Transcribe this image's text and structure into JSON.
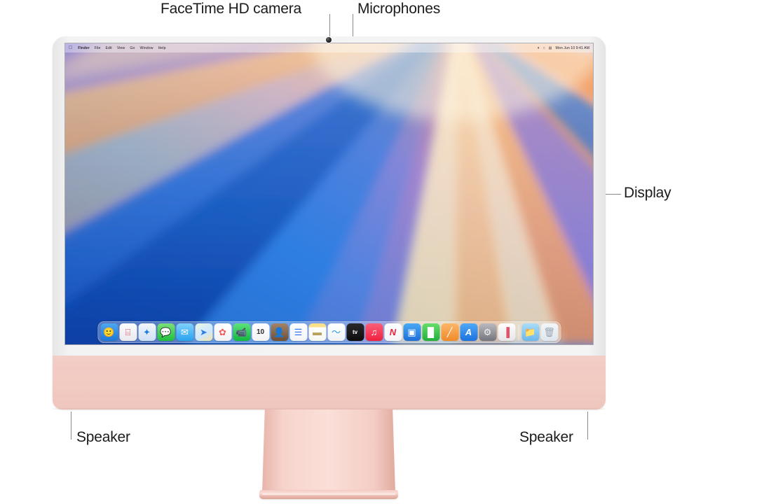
{
  "figure": {
    "title": "iMac front view with callouts",
    "device": "iMac",
    "body_color": "#f2cbc3",
    "bezel_color": "#f0f0f1"
  },
  "callouts": [
    {
      "id": "facetime-camera",
      "label": "FaceTime HD camera"
    },
    {
      "id": "microphones",
      "label": "Microphones"
    },
    {
      "id": "display",
      "label": "Display"
    },
    {
      "id": "speaker-left",
      "label": "Speaker"
    },
    {
      "id": "speaker-right",
      "label": "Speaker"
    }
  ],
  "screen": {
    "menubar": {
      "apple_glyph": "",
      "left_items": [
        {
          "label": "Finder",
          "bold": true
        },
        {
          "label": "File",
          "bold": false
        },
        {
          "label": "Edit",
          "bold": false
        },
        {
          "label": "View",
          "bold": false
        },
        {
          "label": "Go",
          "bold": false
        },
        {
          "label": "Window",
          "bold": false
        },
        {
          "label": "Help",
          "bold": false
        }
      ],
      "right_icons": [
        {
          "name": "wifi-icon",
          "glyph": "▾"
        },
        {
          "name": "search-icon",
          "glyph": "○"
        },
        {
          "name": "control-center-icon",
          "glyph": "▤"
        }
      ],
      "clock": "Mon Jun 10  9:41 AM"
    },
    "wallpaper": {
      "name": "macOS Sequoia rays",
      "colors": [
        "#1452b8",
        "#2f7ee0",
        "#7b79d6",
        "#b07fc4",
        "#f09a5c",
        "#f7c189",
        "#fbe0b4",
        "#fdf0d8"
      ]
    },
    "dock": {
      "items": [
        {
          "name": "finder",
          "label": "Finder",
          "glyph": "🙂",
          "bg": "linear-gradient(180deg,#4ea7f0,#1e76d8)",
          "fg": "#ffffff"
        },
        {
          "name": "launchpad",
          "label": "Launchpad",
          "glyph": "⌸",
          "bg": "linear-gradient(180deg,#fdfdfd,#e9e9ef)",
          "fg": "#d8485f"
        },
        {
          "name": "safari",
          "label": "Safari",
          "glyph": "✦",
          "bg": "linear-gradient(180deg,#f2f6fb,#cfe0f4)",
          "fg": "#1f7fe0"
        },
        {
          "name": "messages",
          "label": "Messages",
          "glyph": "💬",
          "bg": "linear-gradient(180deg,#7ce07b,#1fbf3d)",
          "fg": "#ffffff"
        },
        {
          "name": "mail",
          "label": "Mail",
          "glyph": "✉",
          "bg": "linear-gradient(180deg,#7fd0fb,#2aa2ef)",
          "fg": "#ffffff"
        },
        {
          "name": "maps",
          "label": "Maps",
          "glyph": "➤",
          "bg": "linear-gradient(150deg,#e7f6e2 0%,#cfe9ff 55%,#f6e6a8 100%)",
          "fg": "#2f7ee0"
        },
        {
          "name": "photos",
          "label": "Photos",
          "glyph": "✿",
          "bg": "linear-gradient(180deg,#ffffff,#f2f2f5)",
          "fg": "#f05a5a"
        },
        {
          "name": "facetime",
          "label": "FaceTime",
          "glyph": "📹",
          "bg": "linear-gradient(180deg,#5ee17a,#12b83e)",
          "fg": "#ffffff"
        },
        {
          "name": "calendar",
          "label": "Calendar",
          "glyph": "10",
          "bg": "linear-gradient(180deg,#ffffff,#f3f3f6)",
          "fg": "#2b2b2e"
        },
        {
          "name": "contacts",
          "label": "Contacts",
          "glyph": "👤",
          "bg": "linear-gradient(180deg,#a1846a,#6d4f36)",
          "fg": "#f3e7d8"
        },
        {
          "name": "reminders",
          "label": "Reminders",
          "glyph": "☰",
          "bg": "linear-gradient(180deg,#ffffff,#f4f4f7)",
          "fg": "#3478f6"
        },
        {
          "name": "notes",
          "label": "Notes",
          "glyph": "▬",
          "bg": "linear-gradient(180deg,#fbe08a 0%,#fbe08a 22%,#ffffff 22%,#f6f6f2 100%)",
          "fg": "#b9a15e"
        },
        {
          "name": "freeform",
          "label": "Freeform",
          "glyph": "〜",
          "bg": "linear-gradient(180deg,#ffffff,#eef2f7)",
          "fg": "#2f9ae0"
        },
        {
          "name": "apple-tv",
          "label": "Apple TV",
          "glyph": "tv",
          "bg": "linear-gradient(180deg,#2a2a2e,#0c0c0e)",
          "fg": "#ffffff"
        },
        {
          "name": "music",
          "label": "Music",
          "glyph": "♫",
          "bg": "linear-gradient(180deg,#fb5f7a,#f0203f)",
          "fg": "#ffffff"
        },
        {
          "name": "news",
          "label": "News",
          "glyph": "N",
          "bg": "linear-gradient(180deg,#ffffff,#f5f5f8)",
          "fg": "#f0203f"
        },
        {
          "name": "keynote",
          "label": "Keynote",
          "glyph": "▣",
          "bg": "linear-gradient(180deg,#4aa9f5,#1f6fd8)",
          "fg": "#ffffff"
        },
        {
          "name": "numbers",
          "label": "Numbers",
          "glyph": "█",
          "bg": "linear-gradient(180deg,#66dd6c,#21b03a)",
          "fg": "#ffffff"
        },
        {
          "name": "pages",
          "label": "Pages",
          "glyph": "╱",
          "bg": "linear-gradient(180deg,#fbb768,#f08a2a)",
          "fg": "#ffffff"
        },
        {
          "name": "app-store",
          "label": "App Store",
          "glyph": "A",
          "bg": "linear-gradient(180deg,#4fa9f7,#1c72de)",
          "fg": "#ffffff"
        },
        {
          "name": "system-settings",
          "label": "System Settings",
          "glyph": "⚙",
          "bg": "linear-gradient(180deg,#b9b9bf,#75757d)",
          "fg": "#f2f2f4"
        },
        {
          "name": "iphone-mirroring",
          "label": "iPhone Mirroring",
          "glyph": "▐",
          "bg": "linear-gradient(180deg,#fdfdfd,#e6e6ea)",
          "fg": "#e0536a"
        },
        {
          "name": "dock-separator",
          "label": "",
          "glyph": "",
          "bg": "",
          "fg": ""
        },
        {
          "name": "downloads-folder",
          "label": "Downloads",
          "glyph": "📁",
          "bg": "linear-gradient(180deg,#a9dcf8,#6cb8ec)",
          "fg": "#ffffff"
        },
        {
          "name": "trash",
          "label": "Trash",
          "glyph": "🗑",
          "bg": "linear-gradient(180deg,#f2f6f9,#dfe6ec)",
          "fg": "#9aa7b3"
        }
      ]
    }
  }
}
